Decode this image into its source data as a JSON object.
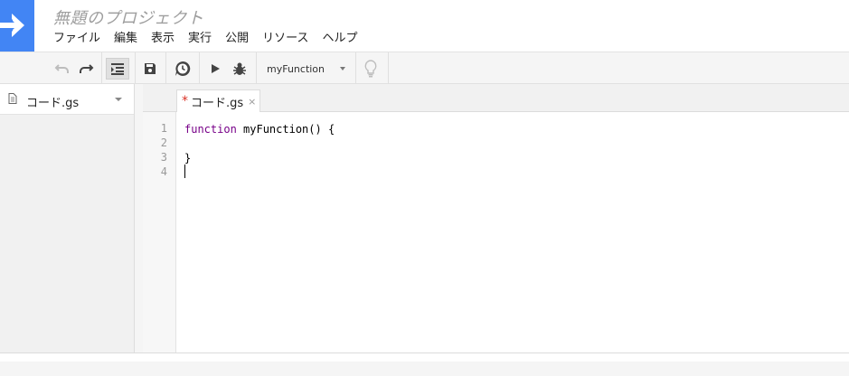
{
  "header": {
    "title": "無題のプロジェクト",
    "logo_icon": "arrow-right-icon",
    "logo_color": "#4285f4"
  },
  "menu": [
    "ファイル",
    "編集",
    "表示",
    "実行",
    "公開",
    "リソース",
    "ヘルプ"
  ],
  "toolbar": {
    "icons": [
      "undo-icon",
      "redo-icon",
      "indent-icon",
      "save-icon",
      "trigger-clock-icon",
      "run-icon",
      "debug-bug-icon",
      "lightbulb-icon"
    ],
    "function_select": "myFunction"
  },
  "sidebar": {
    "files": [
      {
        "name": "コード.gs",
        "icon": "file-icon"
      }
    ]
  },
  "editor": {
    "tab": {
      "label": "コード.gs",
      "modified_marker": "*",
      "close": "×"
    },
    "line_numbers": [
      "1",
      "2",
      "3",
      "4"
    ],
    "code": {
      "line1_keyword": "function",
      "line1_rest": " myFunction() {",
      "line2": "",
      "line3": "}",
      "line4": ""
    }
  }
}
